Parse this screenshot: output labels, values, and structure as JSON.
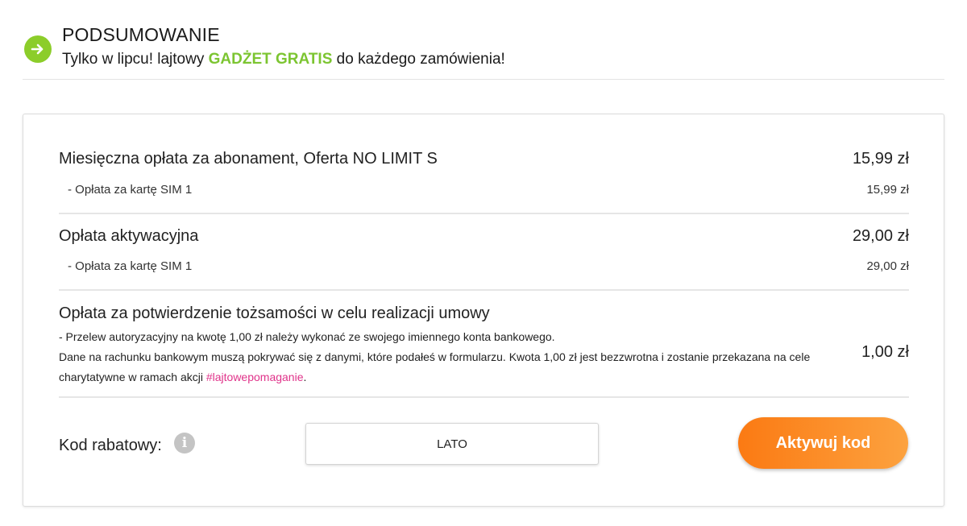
{
  "header": {
    "title": "PODSUMOWANIE",
    "promo_prefix": "Tylko w lipcu! lajtowy ",
    "promo_highlight": "GADŻET GRATIS",
    "promo_suffix": " do każdego zamówienia!",
    "icon": "arrow-right-icon",
    "accent_color": "#8ccd2a"
  },
  "summary": {
    "subscription": {
      "label": "Miesięczna opłata za abonament, Oferta NO LIMIT S",
      "amount": "15,99 zł",
      "sub_label": "- Opłata za kartę SIM 1",
      "sub_amount": "15,99 zł"
    },
    "activation": {
      "label": "Opłata aktywacyjna",
      "amount": "29,00 zł",
      "sub_label": "- Opłata za kartę SIM 1",
      "sub_amount": "29,00 zł"
    },
    "verification": {
      "label": "Opłata za potwierdzenie tożsamości w celu realizacji umowy",
      "line1": "- Przelew autoryzacyjny na kwotę 1,00 zł należy wykonać ze swojego imiennego konta bankowego.",
      "line2": "Dane na rachunku bankowym muszą pokrywać się z danymi, które podałeś w formularzu. Kwota 1,00 zł jest bezzwrotna i zostanie przekazana na cele charytatywne w ramach akcji ",
      "hashtag": "#lajtowepomaganie",
      "line2_end": ".",
      "amount": "1,00 zł"
    }
  },
  "discount": {
    "label": "Kod rabatowy:",
    "info_icon": "info-icon",
    "info_glyph": "i",
    "code_value": "LATO",
    "button_label": "Aktywuj kod",
    "button_color": "#fb7a13"
  }
}
